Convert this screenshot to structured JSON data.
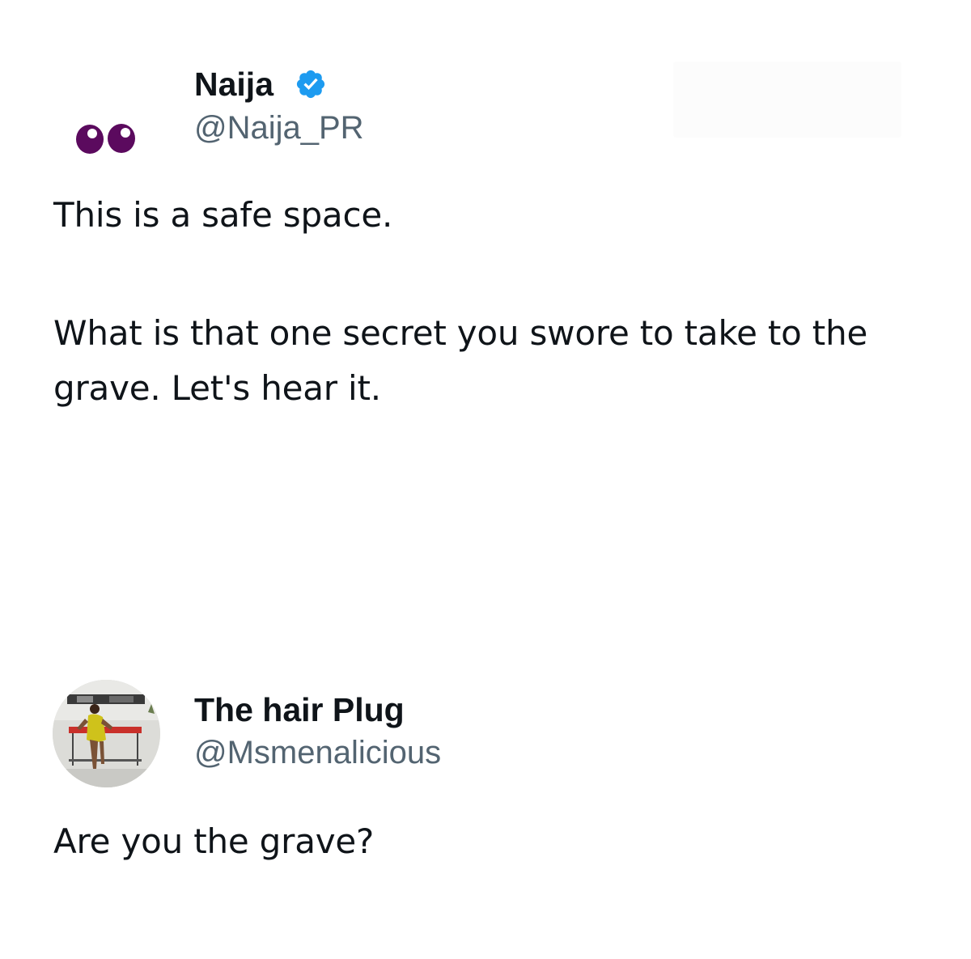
{
  "tweets": [
    {
      "author": {
        "display_name": "Naija",
        "handle": "@Naija_PR",
        "verified": true,
        "avatar_icon": "eyes-emoji"
      },
      "paragraphs": [
        "This is a safe space.",
        "What is that one secret you swore to take to the grave. Let's hear it."
      ]
    },
    {
      "author": {
        "display_name": "The hair Plug",
        "handle": "@Msmenalicious",
        "verified": false,
        "avatar_icon": "profile-photo"
      },
      "paragraphs": [
        "Are you the grave?"
      ]
    }
  ],
  "colors": {
    "text_primary": "#0f1419",
    "text_secondary": "#536471",
    "verified_blue": "#1d9bf0",
    "emoji_purple": "#5b0a5e"
  }
}
